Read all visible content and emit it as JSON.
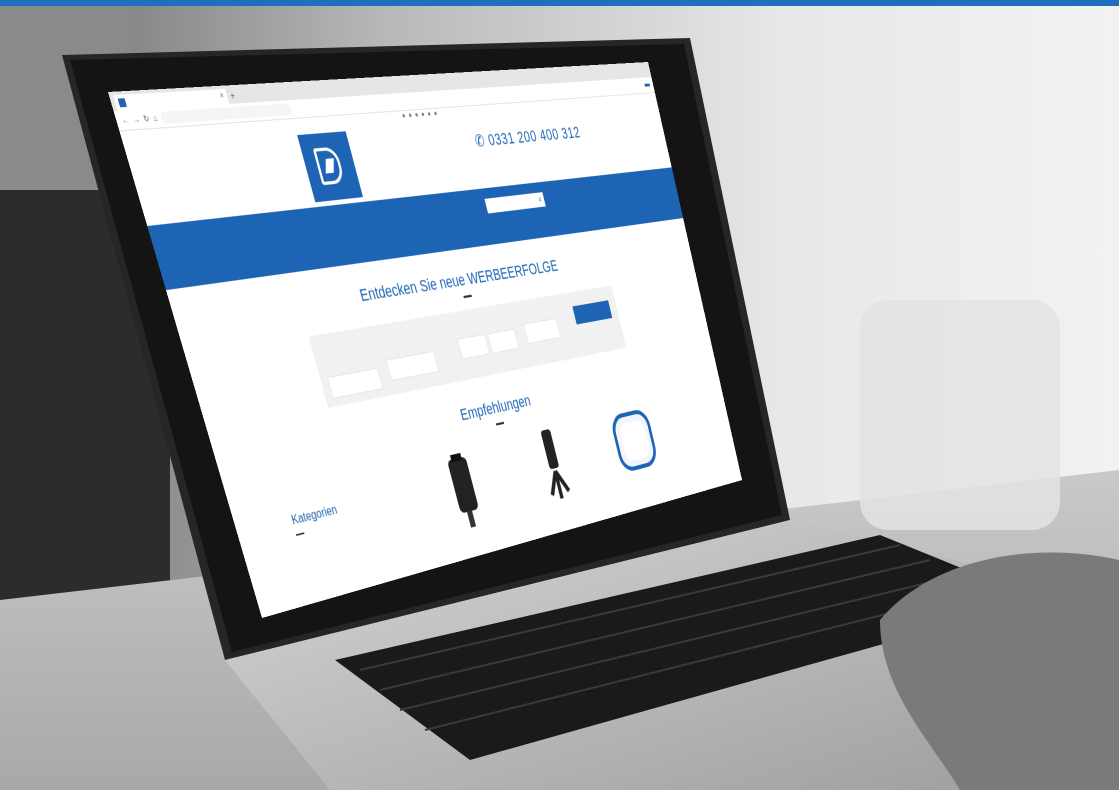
{
  "screen": {
    "tab_title": "",
    "url": "",
    "register_button": "",
    "phone": "0331 200 400 312",
    "phone_subtitle": "",
    "search_placeholder": "",
    "nav": [
      "",
      ""
    ],
    "discover_title": "Entdecken Sie neue WERBEERFOLGE",
    "filter": {
      "labels": [
        "",
        "",
        "",
        ""
      ],
      "button": ""
    },
    "recommend_title": "Empfehlungen",
    "categories_title": "Kategorien",
    "categories": [
      "",
      "",
      "",
      "",
      ""
    ],
    "products": [
      {
        "name": "",
        "price": ""
      },
      {
        "name": "",
        "price": ""
      },
      {
        "name": "",
        "price": ""
      }
    ]
  },
  "colors": {
    "brand_blue": "#1e64b4"
  },
  "icons": [
    "logo-icon",
    "search-icon",
    "phone-icon",
    "car-holder-icon",
    "charger-icon"
  ]
}
